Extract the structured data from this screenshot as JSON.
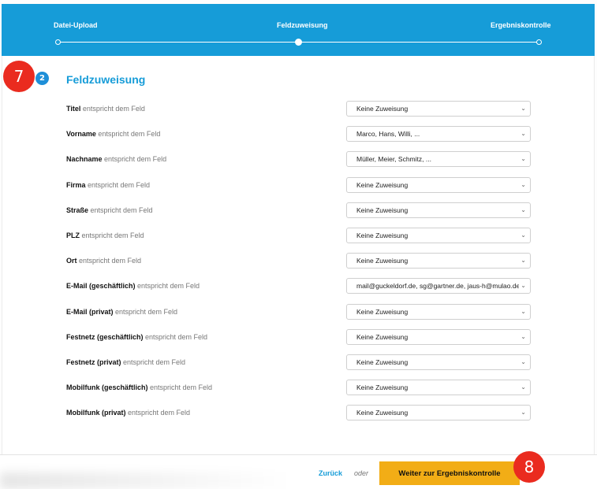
{
  "stepper": {
    "steps": [
      {
        "label": "Datei-Upload",
        "state": "done"
      },
      {
        "label": "Feldzuweisung",
        "state": "active"
      },
      {
        "label": "Ergebniskontrolle",
        "state": "pending"
      }
    ]
  },
  "callouts": {
    "step_number_badge": "2",
    "annotation_7": "7",
    "annotation_8": "8"
  },
  "section": {
    "title": "Feldzuweisung",
    "relation_text": "entspricht dem Feld"
  },
  "fields": [
    {
      "name": "Titel",
      "value": "Keine Zuweisung"
    },
    {
      "name": "Vorname",
      "value": "Marco, Hans, Willi, ..."
    },
    {
      "name": "Nachname",
      "value": "Müller, Meier, Schmitz, ..."
    },
    {
      "name": "Firma",
      "value": "Keine Zuweisung"
    },
    {
      "name": "Straße",
      "value": "Keine Zuweisung"
    },
    {
      "name": "PLZ",
      "value": "Keine Zuweisung"
    },
    {
      "name": "Ort",
      "value": "Keine Zuweisung"
    },
    {
      "name": "E-Mail (geschäftlich)",
      "value": "mail@guckeldorf.de, sg@gartner.de, jaus-h@mulao.de"
    },
    {
      "name": "E-Mail (privat)",
      "value": "Keine Zuweisung"
    },
    {
      "name": "Festnetz (geschäftlich)",
      "value": "Keine Zuweisung"
    },
    {
      "name": "Festnetz (privat)",
      "value": "Keine Zuweisung"
    },
    {
      "name": "Mobilfunk (geschäftlich)",
      "value": "Keine Zuweisung"
    },
    {
      "name": "Mobilfunk (privat)",
      "value": "Keine Zuweisung"
    }
  ],
  "footer": {
    "back_label": "Zurück",
    "or_label": "oder",
    "next_label": "Weiter zur Ergebniskontrolle"
  },
  "colors": {
    "brand_blue": "#169cd8",
    "accent_orange": "#f2ad16",
    "annotation_red": "#ea2b1f"
  },
  "icons": {
    "select_chevron": "chevron-down-icon"
  }
}
